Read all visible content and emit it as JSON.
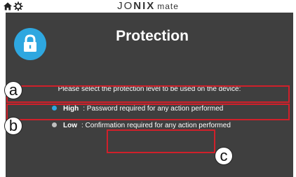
{
  "header": {
    "brand_part1": "JO",
    "brand_part2": "NIX",
    "brand_part3": "mate",
    "icons": [
      "home-icon",
      "gear-icon"
    ]
  },
  "page": {
    "title": "Protection",
    "lock_icon": "lock-icon",
    "prompt": "Please select the protection level to be used on the device:"
  },
  "options": [
    {
      "name": "High",
      "description": ": Password required for any action performed",
      "selected": true
    },
    {
      "name": "Low",
      "description": ": Confirmation required for any action performed",
      "selected": false
    }
  ],
  "callouts": {
    "a": "a",
    "b": "b",
    "c": "c"
  },
  "colors": {
    "panel_bg": "#3f3f3f",
    "accent": "#2ea7e0",
    "highlight": "#d0202a",
    "radio_off": "#bfbfbf"
  }
}
